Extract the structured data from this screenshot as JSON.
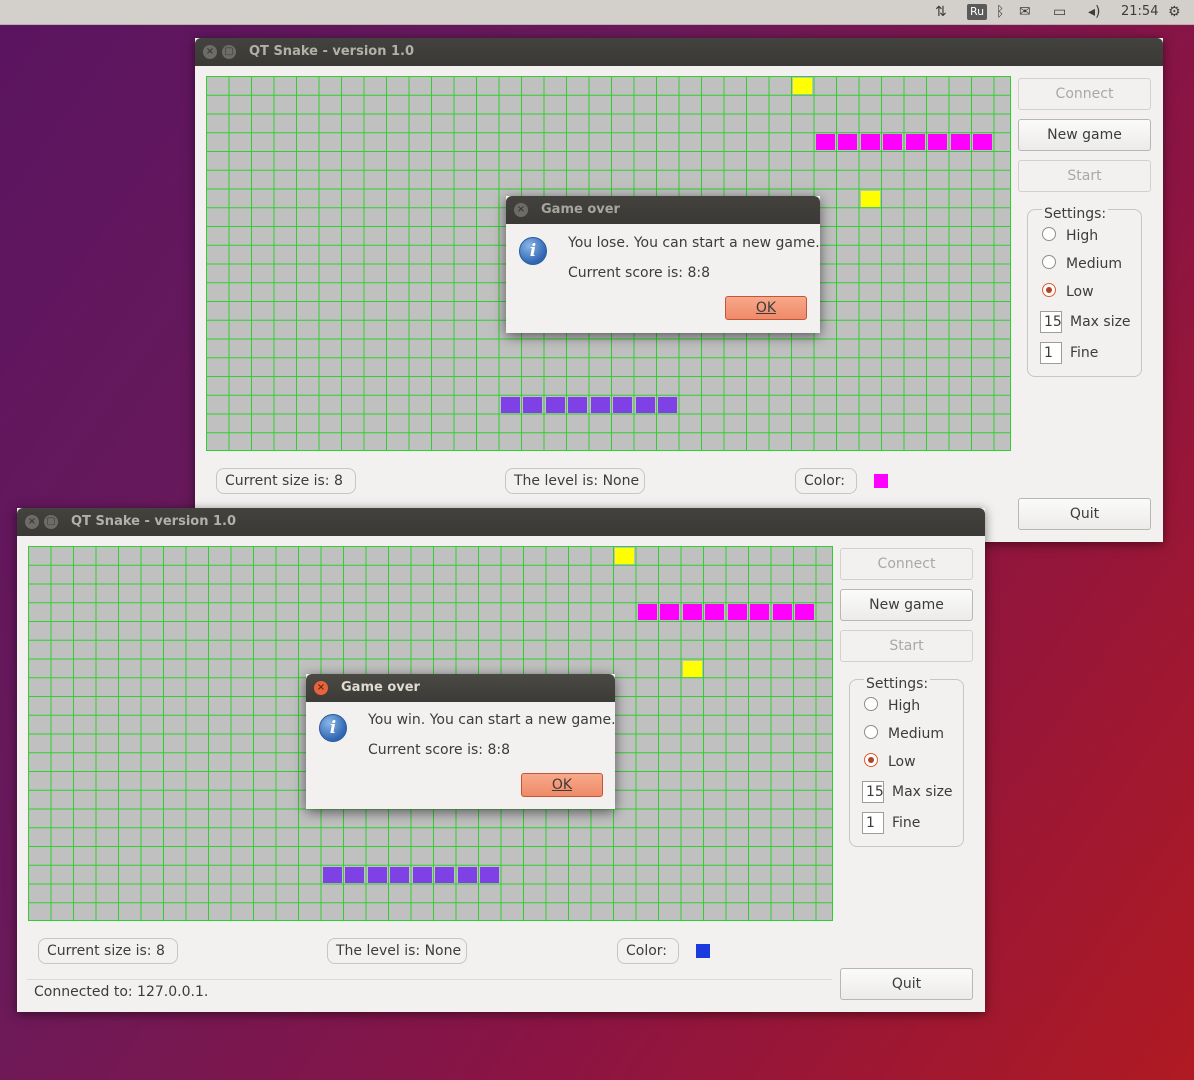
{
  "top_panel": {
    "keyboard_layout": "Ru",
    "time": "21:54",
    "icons": [
      "network-arrows-icon",
      "bluetooth-icon",
      "mail-icon",
      "battery-icon",
      "volume-icon",
      "gear-icon"
    ]
  },
  "window1": {
    "title": "QT Snake - version 1.0",
    "buttons": {
      "connect": "Connect",
      "new_game": "New game",
      "start": "Start",
      "quit": "Quit"
    },
    "settings": {
      "title": "Settings:",
      "options": [
        "High",
        "Medium",
        "Low"
      ],
      "selected": "Low",
      "max_size_value": "15",
      "max_size_label": "Max size",
      "fine_value": "1",
      "fine_label": "Fine"
    },
    "current_size": "Current size is: 8",
    "level": "The level is: None",
    "color_label": "Color:",
    "player_color": "#ff00ff",
    "dialog": {
      "title": "Game over",
      "message": "You lose. You can start a new game.",
      "score": "Current score is: 8:8",
      "ok": "OK"
    }
  },
  "window2": {
    "title": "QT Snake - version 1.0",
    "buttons": {
      "connect": "Connect",
      "new_game": "New game",
      "start": "Start",
      "quit": "Quit"
    },
    "settings": {
      "title": "Settings:",
      "options": [
        "High",
        "Medium",
        "Low"
      ],
      "selected": "Low",
      "max_size_value": "15",
      "max_size_label": "Max size",
      "fine_value": "1",
      "fine_label": "Fine"
    },
    "current_size": "Current size is: 8",
    "level": "The level is: None",
    "color_label": "Color:",
    "player_color": "#1a3ae0",
    "status": "Connected to: 127.0.0.1.",
    "dialog": {
      "title": "Game over",
      "message": "You win. You can start a new game.",
      "score": "Current score is: 8:8",
      "ok": "OK"
    }
  },
  "colors": {
    "food": "#ffff00",
    "snake_magenta": "#ff00ff",
    "snake_purple": "#7f40e6",
    "grid": "#2ed02e",
    "board": "#c0c0c0"
  }
}
